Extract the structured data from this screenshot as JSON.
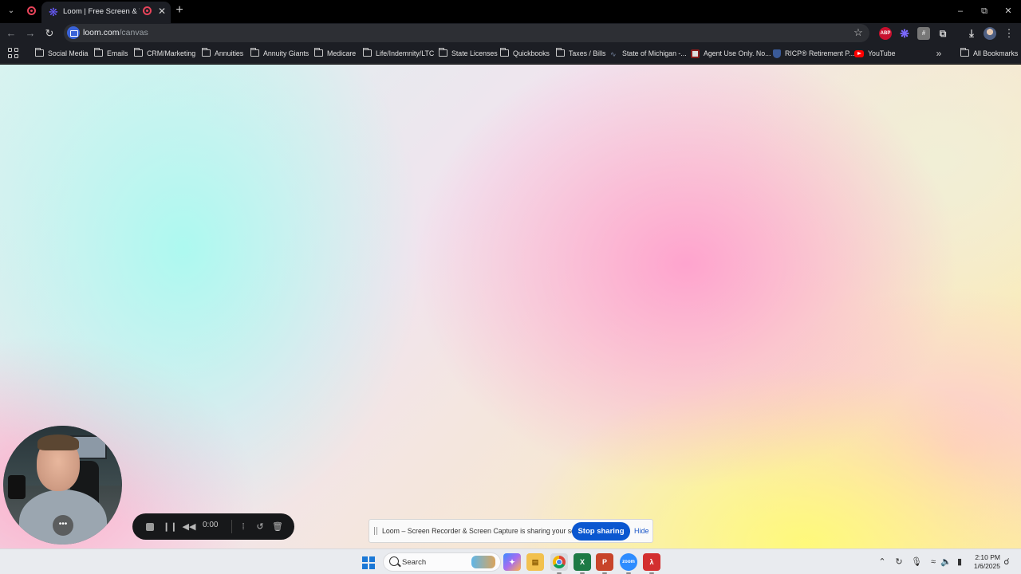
{
  "browser": {
    "active_tab_title": "Loom | Free Screen & Video",
    "url_host": "loom.com",
    "url_path": "/canvas"
  },
  "bookmarks": [
    {
      "label": "Social Media",
      "icon": "folder-icon"
    },
    {
      "label": "Emails",
      "icon": "folder-icon"
    },
    {
      "label": "CRM/Marketing",
      "icon": "folder-icon"
    },
    {
      "label": "Annuities",
      "icon": "folder-icon"
    },
    {
      "label": "Annuity Giants",
      "icon": "folder-icon"
    },
    {
      "label": "Medicare",
      "icon": "folder-icon"
    },
    {
      "label": "Life/Indemnity/LTC",
      "icon": "folder-icon"
    },
    {
      "label": "State Licenses",
      "icon": "folder-icon"
    },
    {
      "label": "Quickbooks",
      "icon": "folder-icon"
    },
    {
      "label": "Taxes / Bills",
      "icon": "folder-icon"
    },
    {
      "label": "State of Michigan -...",
      "icon": "michigan-icon"
    },
    {
      "label": "Agent Use Only. No...",
      "icon": "agent-site-icon"
    },
    {
      "label": "RICP® Retirement P...",
      "icon": "ricp-shield-icon"
    },
    {
      "label": "YouTube",
      "icon": "youtube-icon"
    }
  ],
  "all_bookmarks_label": "All Bookmarks",
  "recorder": {
    "time": "0:00"
  },
  "share_banner": {
    "message": "Loom – Screen Recorder & Screen Capture is sharing your screen.",
    "stop_label": "Stop sharing",
    "hide_label": "Hide"
  },
  "taskbar": {
    "search_placeholder": "Search",
    "apps": [
      "Copilot",
      "File Explorer",
      "Google Chrome",
      "Excel",
      "PowerPoint",
      "Zoom",
      "Adobe Acrobat"
    ],
    "time": "2:10 PM",
    "date": "1/6/2025"
  },
  "colors": {
    "browser_chrome": "#1c1e24",
    "stop_sharing_button": "#0b57d0",
    "recording_red": "#e8445a",
    "taskbar": "#e9ebef"
  }
}
